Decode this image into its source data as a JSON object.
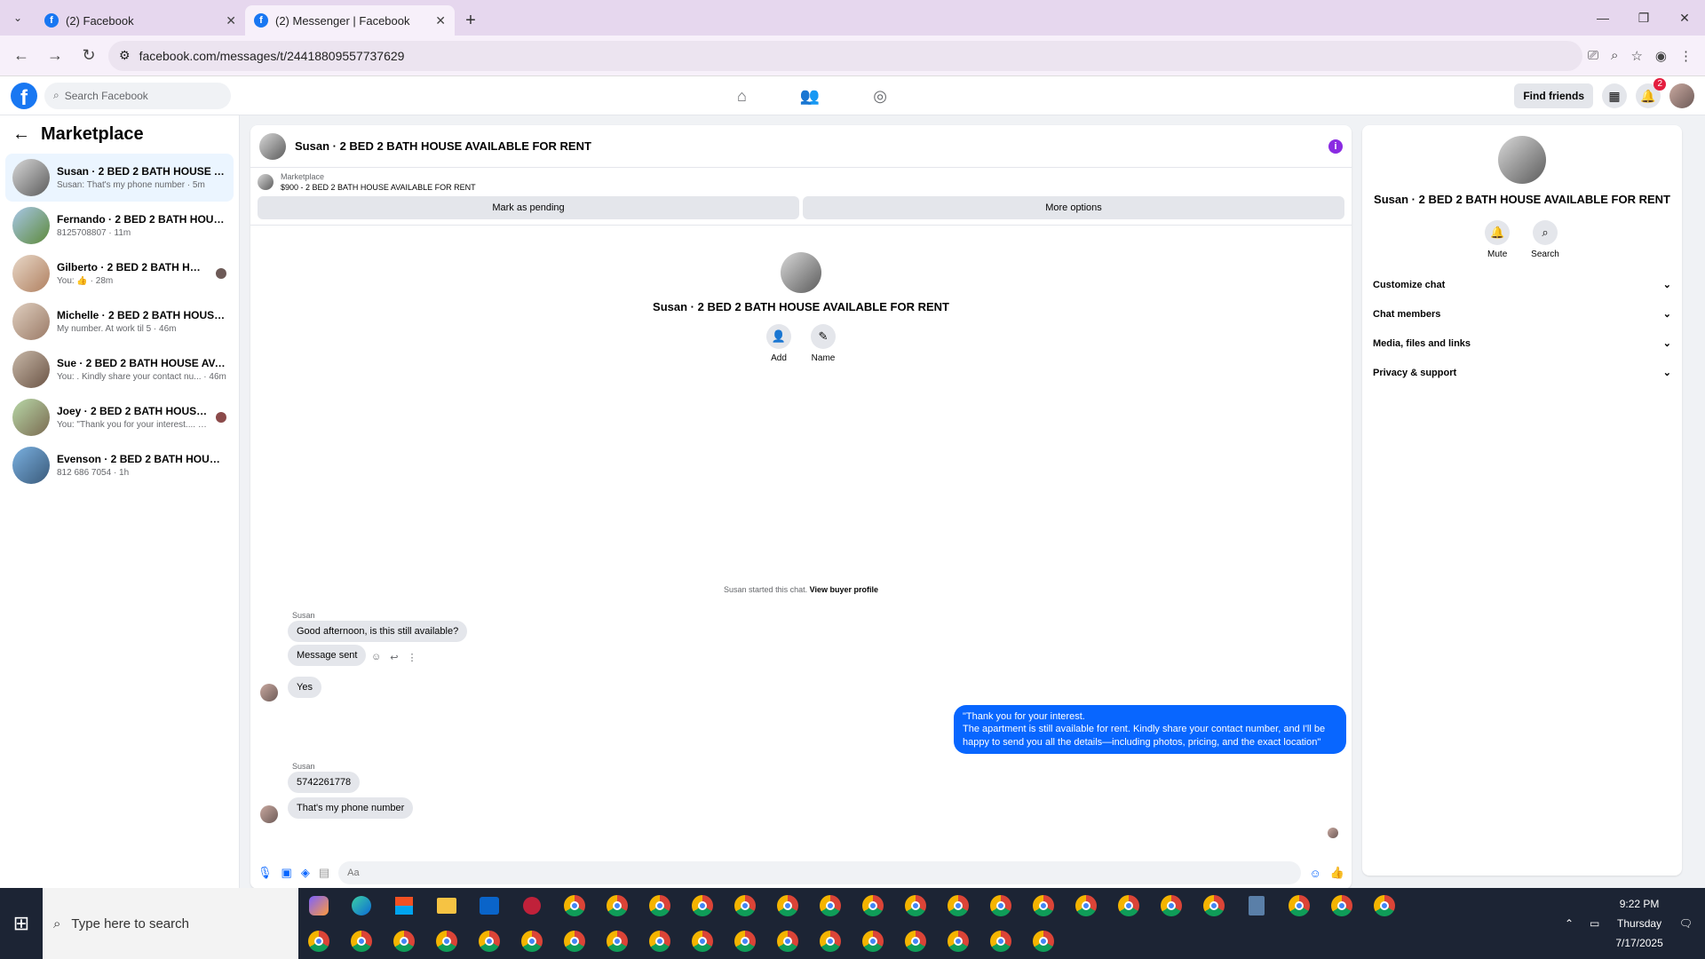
{
  "browser": {
    "tabs": [
      {
        "title": "(2) Facebook",
        "active": false
      },
      {
        "title": "(2) Messenger | Facebook",
        "active": true
      }
    ],
    "url": "facebook.com/messages/t/24418809557737629"
  },
  "fb": {
    "search_placeholder": "Search Facebook",
    "find_friends": "Find friends",
    "notif_count": "2"
  },
  "sidebar": {
    "title": "Marketplace",
    "items": [
      {
        "name": "Susan · 2 BED 2 BATH HOUSE AVAI...",
        "snippet": "Susan: That's my phone number · 5m"
      },
      {
        "name": "Fernando · 2 BED 2 BATH HOUSE ...",
        "snippet": "8125708807 · 11m"
      },
      {
        "name": "Gilberto · 2 BED 2 BATH HOUSE ...",
        "snippet": "You: 👍 · 28m"
      },
      {
        "name": "Michelle · 2 BED 2 BATH HOUSE A...",
        "snippet": "My number. At work til 5 · 46m"
      },
      {
        "name": "Sue · 2 BED 2 BATH HOUSE AVAIL...",
        "snippet": "You: . Kindly share your contact nu... · 46m"
      },
      {
        "name": "Joey · 2 BED 2 BATH HOUSE AV...",
        "snippet": "You: \"Thank you for your interest.... · 51m"
      },
      {
        "name": "Evenson · 2 BED 2 BATH HOUSE A...",
        "snippet": "812 686 7054 · 1h"
      }
    ]
  },
  "chat": {
    "title": "Susan · 2 BED 2 BATH HOUSE AVAILABLE FOR RENT",
    "listing_label": "Marketplace",
    "listing_text": "$900 - 2 BED 2 BATH HOUSE AVAILABLE FOR RENT",
    "mark_pending": "Mark as pending",
    "more_options": "More options",
    "intro_name": "Susan · 2 BED 2 BATH HOUSE AVAILABLE FOR RENT",
    "add_label": "Add",
    "name_label": "Name",
    "started_text": "Susan started this chat.",
    "view_profile": "View buyer profile",
    "sender": "Susan",
    "msg1": "Good afternoon, is this still available?",
    "msg2": "Message sent",
    "msg3": "Yes",
    "my_msg_line1": "\"Thank you for your interest.",
    "my_msg_line2": "The apartment is still available for rent. Kindly share your contact number, and I'll be",
    "my_msg_line3": "happy to send you all the details—including photos, pricing, and the exact location\"",
    "msg4": "5742261778",
    "msg5": "That's my phone number",
    "composer_placeholder": "Aa"
  },
  "rpanel": {
    "name": "Susan · 2 BED 2 BATH HOUSE AVAILABLE FOR RENT",
    "mute": "Mute",
    "search": "Search",
    "sections": [
      "Customize chat",
      "Chat members",
      "Media, files and links",
      "Privacy & support"
    ]
  },
  "taskbar": {
    "search_placeholder": "Type here to search",
    "time": "9:22 PM",
    "day": "Thursday",
    "date": "7/17/2025"
  },
  "colors": {
    "fb_blue": "#1877f2",
    "messenger_blue": "#0866ff",
    "info_purple": "#8a2be2"
  }
}
